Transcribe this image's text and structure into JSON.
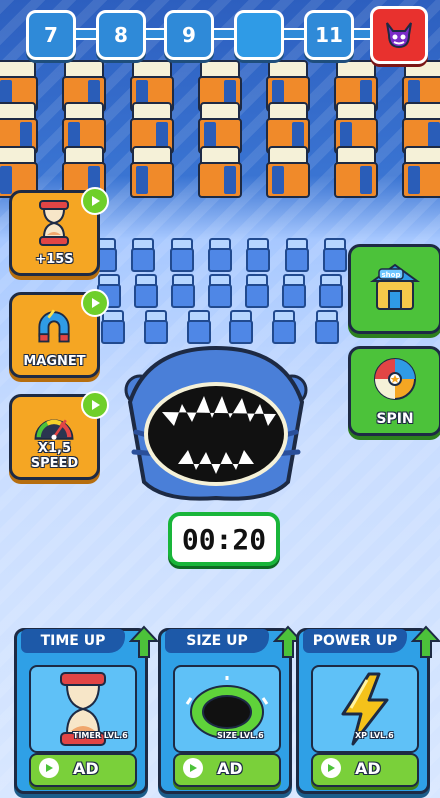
{
  "level_bar": {
    "levels": [
      "7",
      "8",
      "9",
      "",
      "11"
    ],
    "boss_icon": "devil-icon"
  },
  "powerups_left": [
    {
      "label": "+15S",
      "icon": "hourglass-icon"
    },
    {
      "label": "MAGNET",
      "icon": "magnet-icon"
    },
    {
      "label": "X1,5 SPEED",
      "icon": "speedometer-icon"
    }
  ],
  "right_buttons": [
    {
      "label": "",
      "sign": "shop",
      "icon": "shop-icon"
    },
    {
      "label": "SPIN",
      "icon": "spin-wheel-icon"
    }
  ],
  "timer": "00:20",
  "upgrade_cards": [
    {
      "title": "TIME UP",
      "sub": "TIMER LVL.6",
      "ad": "AD",
      "icon": "hourglass-icon"
    },
    {
      "title": "SIZE UP",
      "sub": "SIZE LVL.6",
      "ad": "AD",
      "icon": "hole-ring-icon"
    },
    {
      "title": "POWER UP",
      "sub": "XP LVL.6",
      "ad": "AD",
      "icon": "lightning-icon"
    }
  ],
  "colors": {
    "level_blue": "#2f8ad8",
    "boss_red": "#e8312e",
    "powerup_orange": "#f5a623",
    "green_button": "#4cc23a",
    "timer_border": "#19b53a",
    "card_blue": "#2fa0e6"
  }
}
